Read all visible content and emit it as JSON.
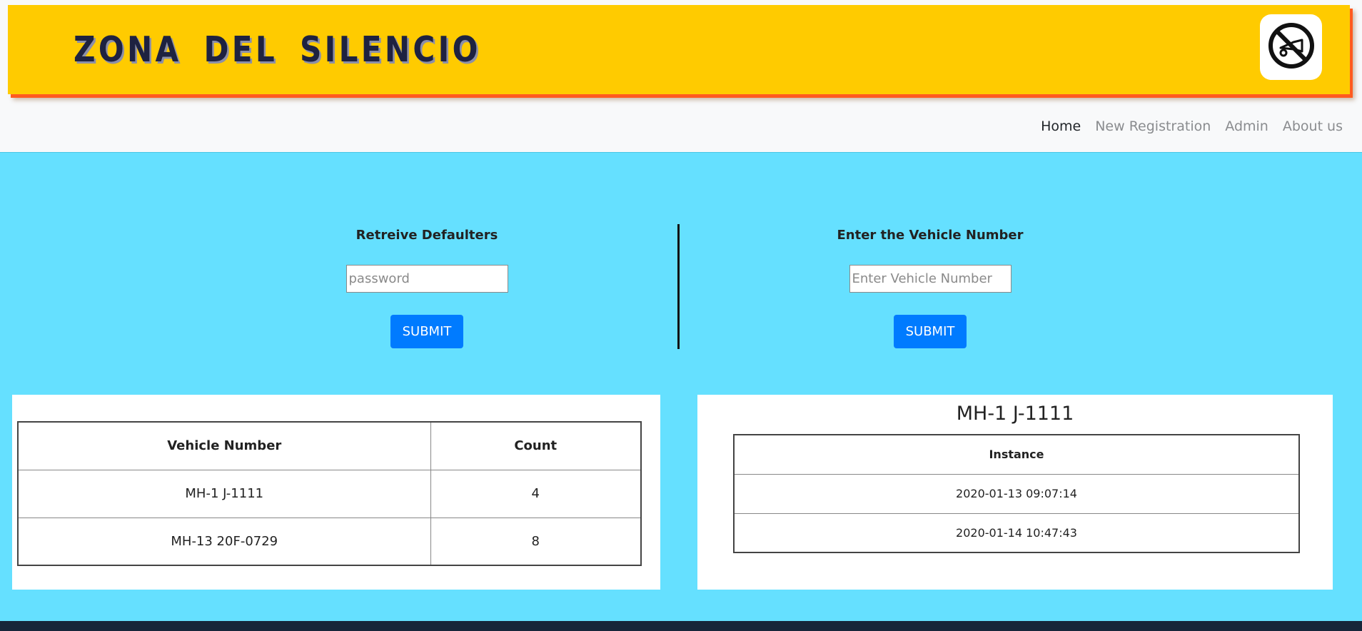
{
  "header": {
    "brand": "ZONA DEL SILENCIO",
    "logo_icon": "no-horn-icon",
    "banner_color": "#ffcb00"
  },
  "nav": {
    "items": [
      {
        "label": "Home",
        "active": true
      },
      {
        "label": "New Registration",
        "active": false
      },
      {
        "label": "Admin",
        "active": false
      },
      {
        "label": "About us",
        "active": false
      }
    ]
  },
  "defaulters_form": {
    "title": "Retreive Defaulters",
    "placeholder": "password",
    "submit_label": "SUBMIT"
  },
  "vehicle_form": {
    "title": "Enter the Vehicle Number",
    "placeholder": "Enter Vehicle Number",
    "submit_label": "SUBMIT"
  },
  "defaulters_table": {
    "headers": [
      "Vehicle Number",
      "Count"
    ],
    "rows": [
      {
        "vehicle": "MH-1 J-1111",
        "count": "4"
      },
      {
        "vehicle": "MH-13 20F-0729",
        "count": "8"
      }
    ]
  },
  "instance_panel": {
    "title": "MH-1 J-1111",
    "header": "Instance",
    "rows": [
      "2020-01-13 09:07:14",
      "2020-01-14 10:47:43"
    ]
  },
  "colors": {
    "main_bg": "#65e0ff",
    "button": "#007bff",
    "banner_shadow": "#ff5a1f"
  }
}
